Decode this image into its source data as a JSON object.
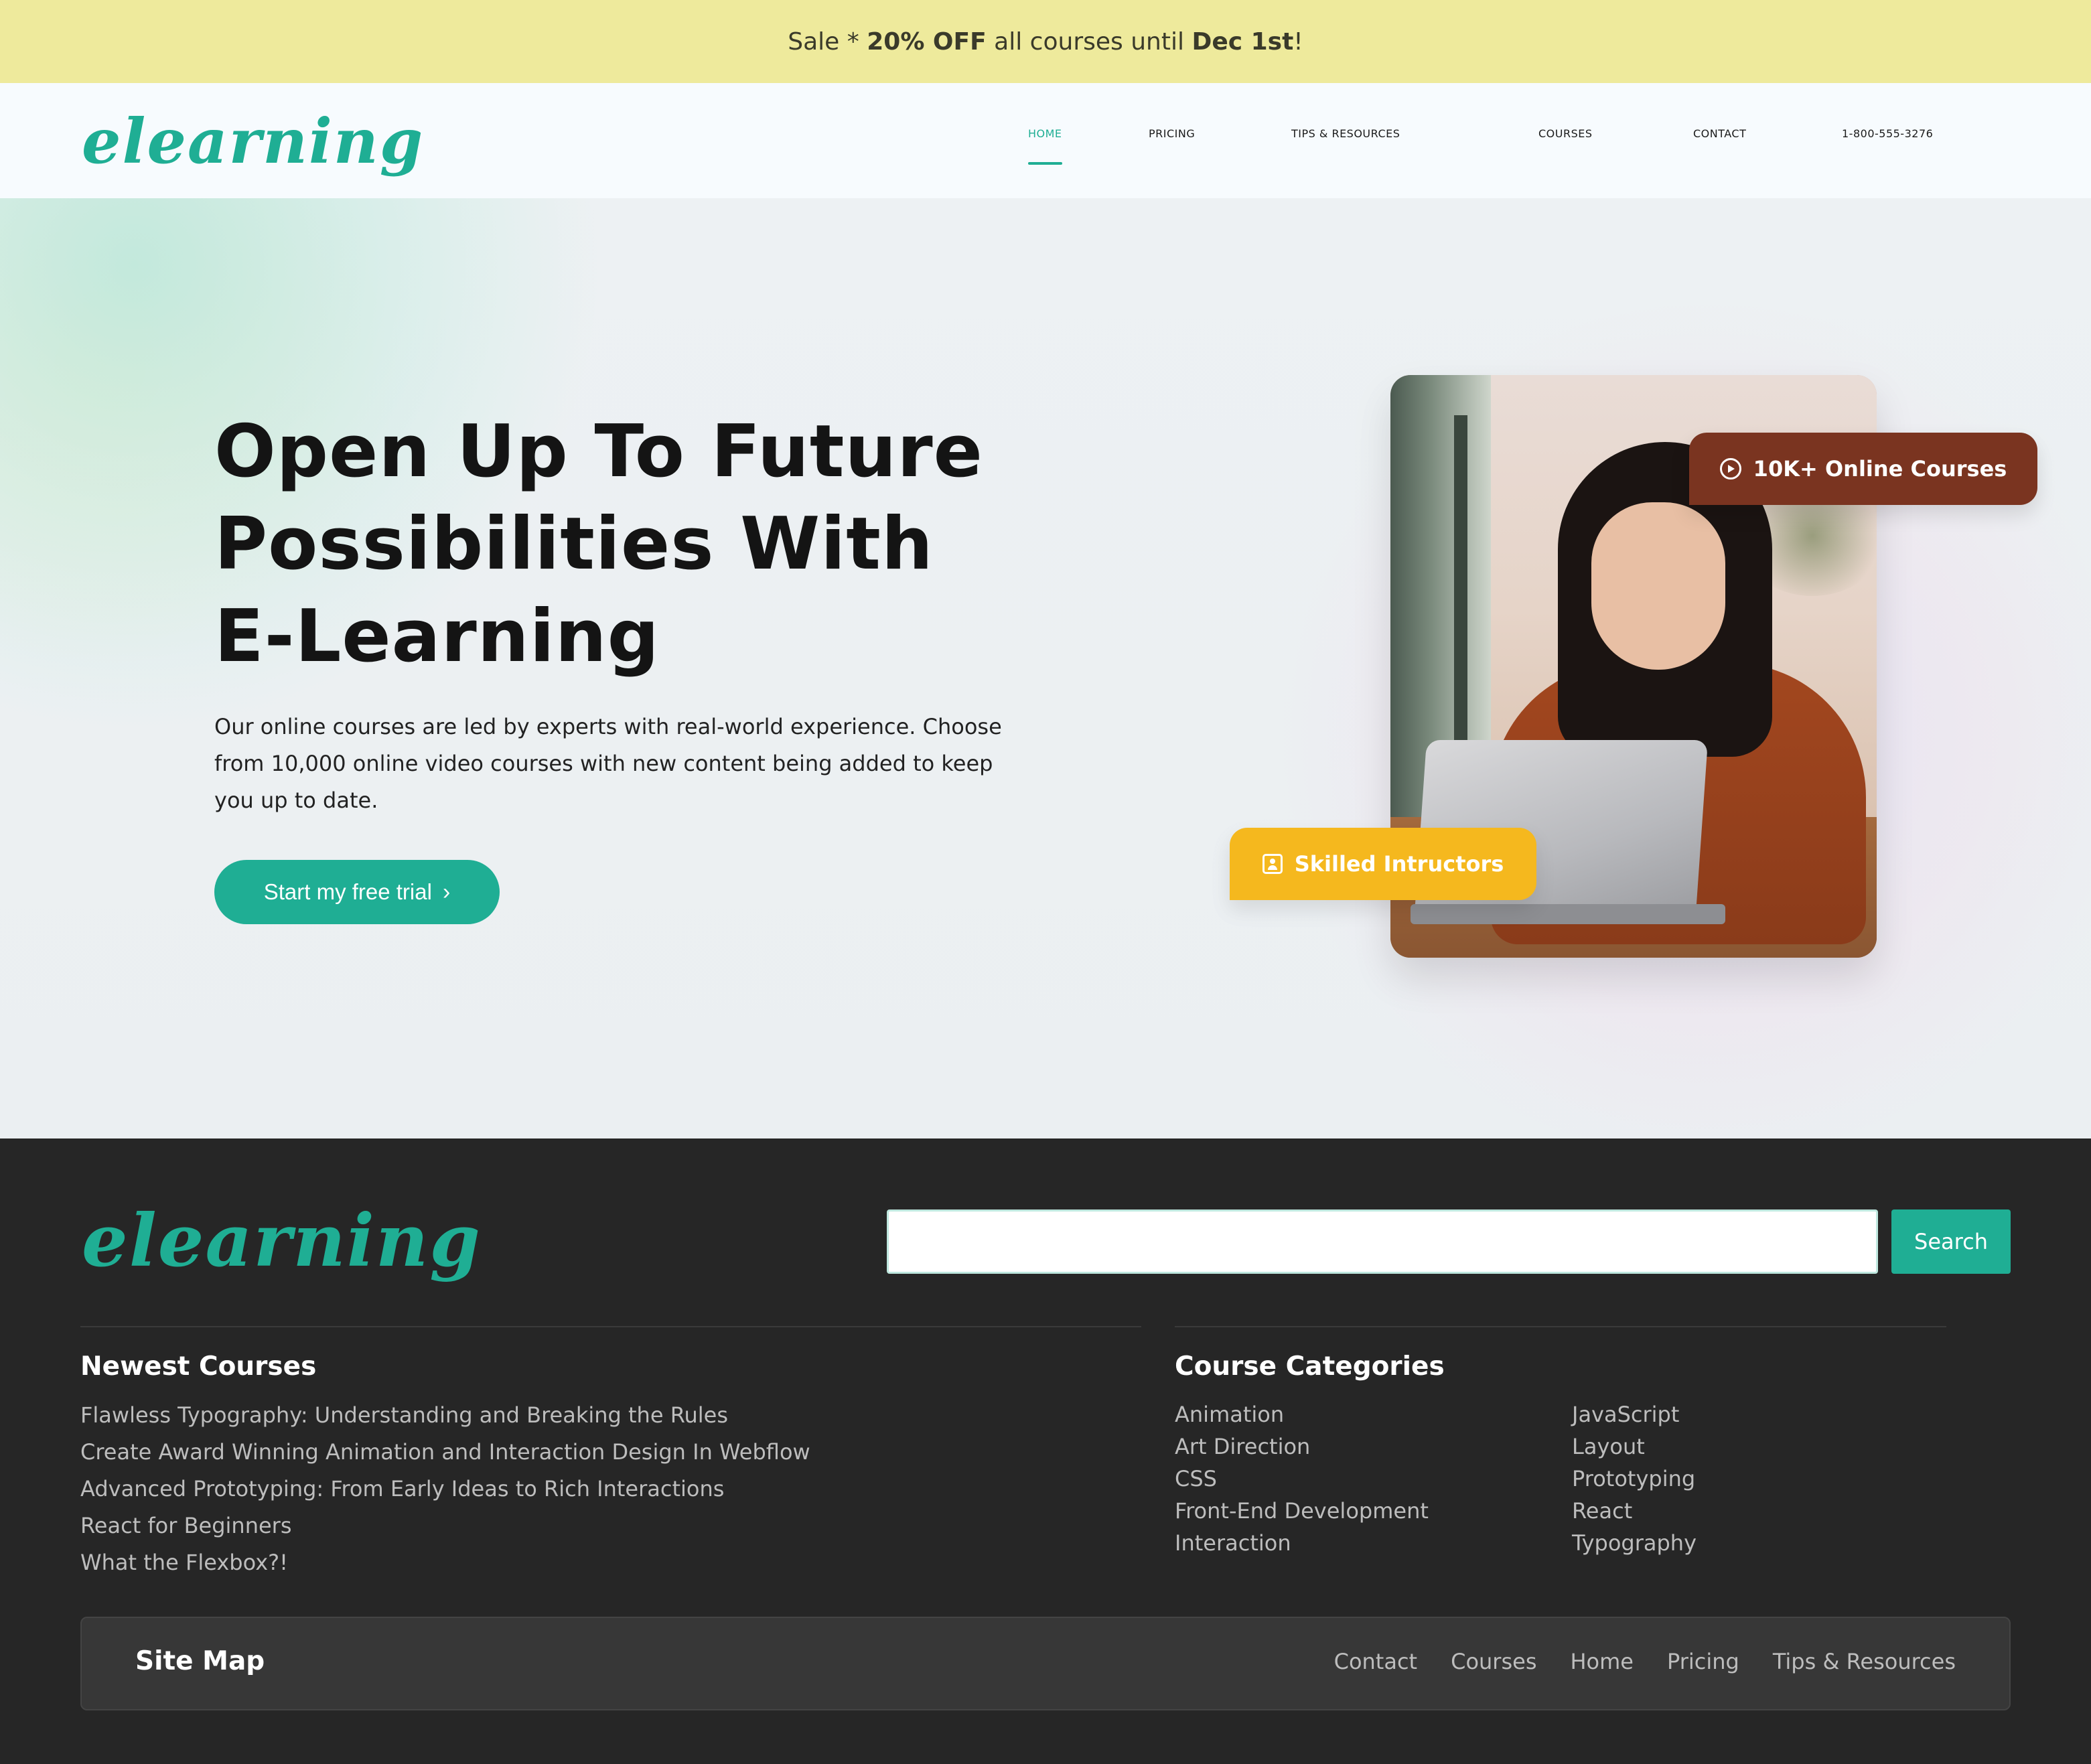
{
  "banner": {
    "prefix": "Sale * ",
    "discount": "20% OFF",
    "middle": " all courses until ",
    "date": "Dec 1st",
    "suffix": "!"
  },
  "header": {
    "logo": "elearning",
    "nav": [
      {
        "label": "HOME",
        "active": true
      },
      {
        "label": "PRICING"
      },
      {
        "label": "TIPS & RESOURCES"
      },
      {
        "label": "COURSES"
      },
      {
        "label": "CONTACT"
      }
    ],
    "phone": "1-800-555-3276"
  },
  "hero": {
    "title_lines": [
      "Open Up To Future",
      "Possibilities With",
      "E-Learning"
    ],
    "description": "Our online courses are led by experts with real-world experience. Choose from 10,000 online video courses with new content being added to keep you up to date.",
    "cta_label": "Start my free trial",
    "badge_courses": "10K+ Online Courses",
    "badge_instructors": "Skilled Intructors"
  },
  "footer": {
    "logo": "elearning",
    "search_value": "",
    "search_button": "Search",
    "newest_title": "Newest Courses",
    "newest_courses": [
      "Flawless Typography: Understanding and Breaking the Rules",
      "Create Award Winning Animation and Interaction Design In Webflow",
      "Advanced Prototyping: From Early Ideas to Rich Interactions",
      "React for Beginners",
      "What the Flexbox?!"
    ],
    "categories_title": "Course Categories",
    "categories_col1": [
      "Animation",
      "Art Direction",
      "CSS",
      "Front-End Development",
      "Interaction"
    ],
    "categories_col2": [
      "JavaScript",
      "Layout",
      "Prototyping",
      "React",
      "Typography"
    ],
    "sitemap_title": "Site Map",
    "sitemap_links": [
      "Contact",
      "Courses",
      "Home",
      "Pricing",
      "Tips & Resources"
    ]
  },
  "colors": {
    "brand": "#1fae94",
    "banner_bg": "#eeea9c",
    "badge_courses": "#7a3420",
    "badge_instructors": "#f5b81e",
    "footer_bg": "#262626"
  }
}
